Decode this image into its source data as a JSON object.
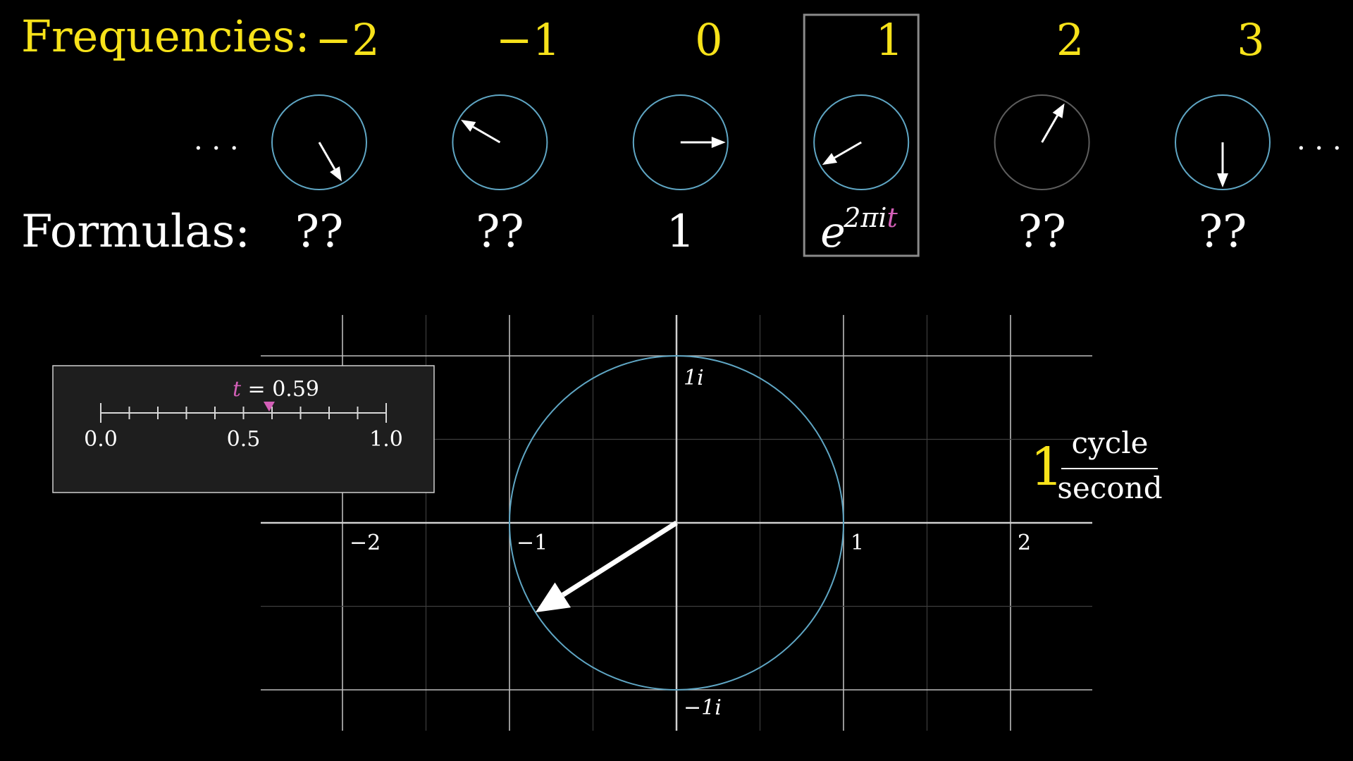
{
  "header": {
    "frequencies_label": "Frequencies:",
    "formulas_label": "Formulas:",
    "left_ellipsis": ". . .",
    "right_ellipsis": ". . ."
  },
  "frequency_columns": [
    {
      "frequency": "−2",
      "formula": "??",
      "highlighted": false,
      "ring_color": "#5fa6c4",
      "arrow_angle_deg": -60
    },
    {
      "frequency": "−1",
      "formula": "??",
      "highlighted": false,
      "ring_color": "#5fa6c4",
      "arrow_angle_deg": 150
    },
    {
      "frequency": "0",
      "formula": "1",
      "highlighted": false,
      "ring_color": "#5fa6c4",
      "arrow_angle_deg": 0
    },
    {
      "frequency": "1",
      "formula": "",
      "highlighted": true,
      "ring_color": "#5fa6c4",
      "arrow_angle_deg": -150
    },
    {
      "frequency": "2",
      "formula": "??",
      "highlighted": false,
      "ring_color": "#5d5d5d",
      "arrow_angle_deg": 60
    },
    {
      "frequency": "3",
      "formula": "??",
      "highlighted": false,
      "ring_color": "#5fa6c4",
      "arrow_angle_deg": -90
    }
  ],
  "highlight_formula": {
    "base": "e",
    "exponent_prefix": "2πi",
    "exponent_var": "t"
  },
  "time_slider": {
    "var": "t",
    "equals_value": " = 0.59",
    "value": 0.59,
    "min": 0,
    "max": 1,
    "tick_count": 10,
    "tick_labels": [
      {
        "v": 0.0,
        "label": "0.0"
      },
      {
        "v": 0.5,
        "label": "0.5"
      },
      {
        "v": 1.0,
        "label": "1.0"
      }
    ]
  },
  "complex_plane": {
    "x_range": [
      -2.0,
      2.0
    ],
    "y_range": [
      -1.0,
      1.0
    ],
    "x_tick_labels": [
      {
        "v": -2,
        "label": "−2"
      },
      {
        "v": -1,
        "label": "−1"
      },
      {
        "v": 1,
        "label": "1"
      },
      {
        "v": 2,
        "label": "2"
      }
    ],
    "y_tick_labels": [
      {
        "v": 1,
        "label": "1i"
      },
      {
        "v": -1,
        "label": "−1i"
      }
    ],
    "unit_circle_radius": 1,
    "vector_angle_deg": 212.4
  },
  "rate_label": {
    "number": "1",
    "numerator": "cycle",
    "denominator": "second"
  },
  "colors": {
    "yellow": "#f7e21a",
    "white": "#ffffff",
    "ring_blue": "#5fa6c4",
    "ring_gray": "#5d5d5d",
    "pink": "#d35fb7",
    "grid": "#5a5a5a",
    "axis": "#d0d0d0",
    "panel_bg": "#1e1e1e",
    "highlight_border": "#8a8a8a"
  }
}
